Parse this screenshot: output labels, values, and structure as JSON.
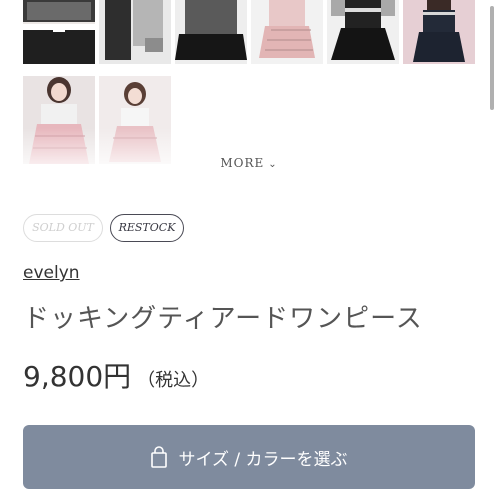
{
  "gallery": {
    "more_label": "MORE",
    "more_icon": "chevron-down-icon"
  },
  "badges": {
    "sold_out": "SOLD OUT",
    "restock": "RESTOCK"
  },
  "product": {
    "brand": "evelyn",
    "name": "ドッキングティアードワンピース",
    "price": "9,800円",
    "tax_note": "（税込）"
  },
  "actions": {
    "select_button_label": "サイズ / カラーを選ぶ",
    "select_button_icon": "shopping-bag-icon"
  },
  "colors": {
    "button_bg": "#7f8b9e",
    "text": "#333333",
    "muted": "#cfcfcf"
  }
}
